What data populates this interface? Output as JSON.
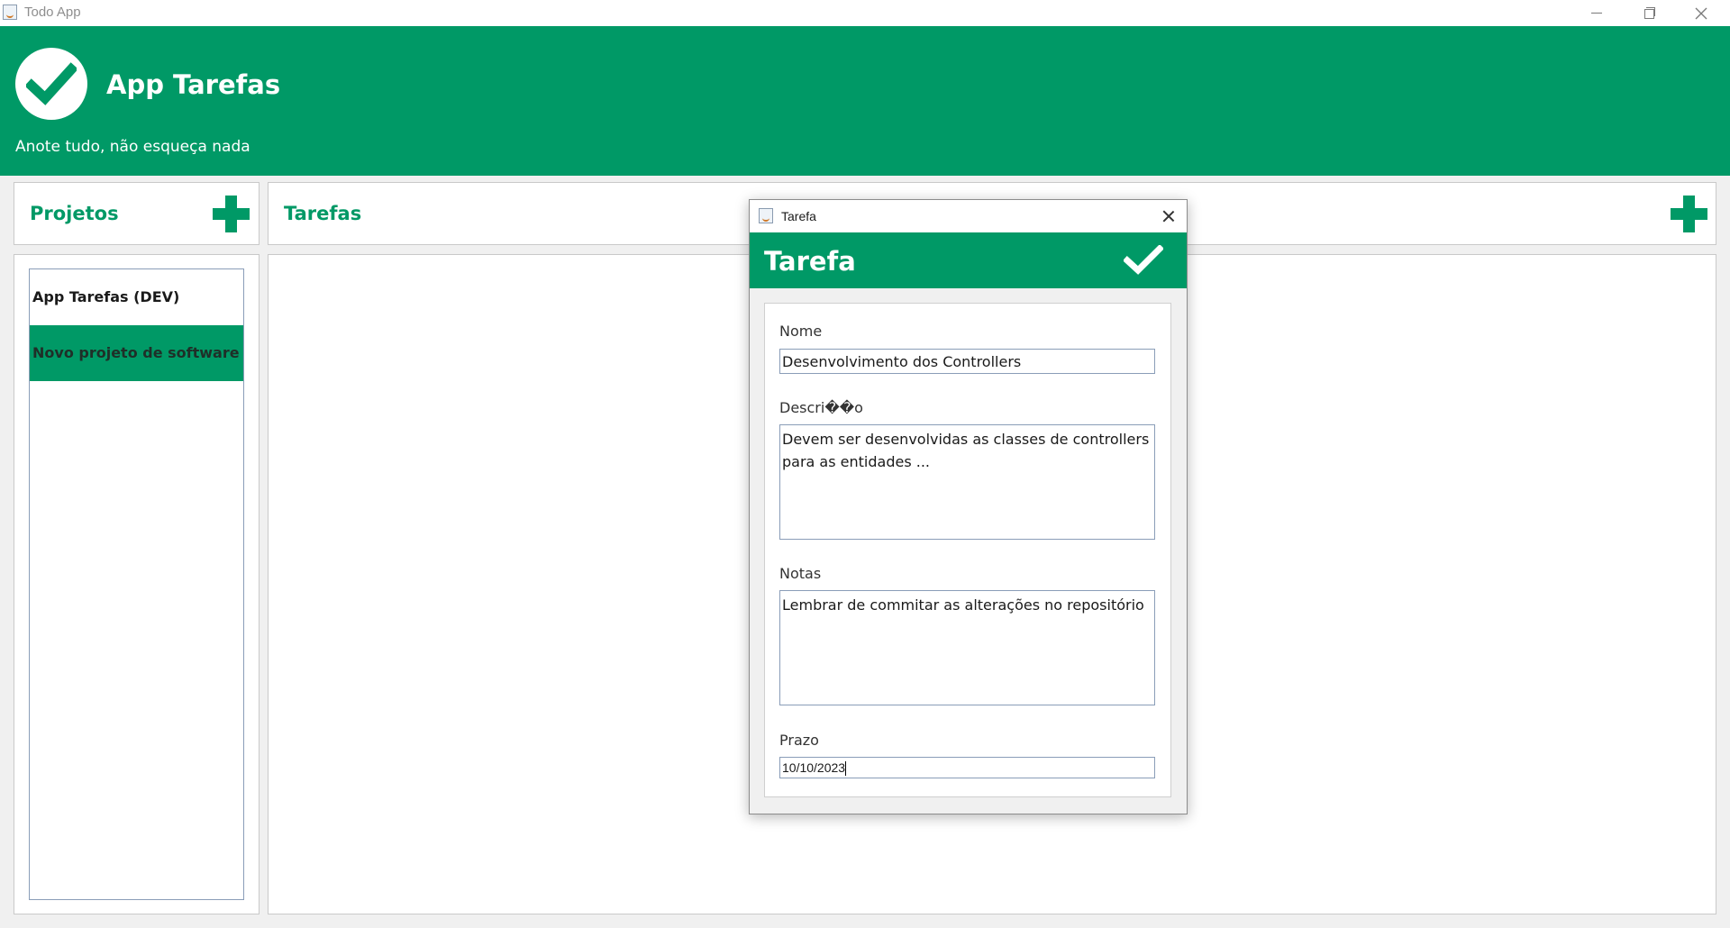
{
  "window": {
    "title": "Todo App",
    "icon": "java-cup-icon"
  },
  "header": {
    "title": "App Tarefas",
    "subtitle": "Anote tudo, não esqueça nada",
    "logo_icon": "check-circle-icon"
  },
  "projects": {
    "title": "Projetos",
    "add_icon": "plus-icon",
    "items": [
      {
        "label": "App Tarefas (DEV)",
        "selected": false
      },
      {
        "label": "Novo projeto de software",
        "selected": true
      }
    ]
  },
  "tasks": {
    "title": "Tarefas",
    "add_icon": "plus-icon"
  },
  "dialog": {
    "window_title": "Tarefa",
    "header_title": "Tarefa",
    "confirm_icon": "check-icon",
    "close_icon": "close-icon",
    "fields": {
      "nome": {
        "label": "Nome",
        "value": "Desenvolvimento dos Controllers"
      },
      "descricao": {
        "label": "Descri��o",
        "value": "Devem ser desenvolvidas as classes de controllers\npara as entidades ..."
      },
      "notas": {
        "label": "Notas",
        "value": "Lembrar de commitar as alterações no repositório"
      },
      "prazo": {
        "label": "Prazo",
        "value": "10/10/2023"
      }
    }
  },
  "colors": {
    "primary": "#009966",
    "background": "#f0f0f0",
    "white": "#ffffff"
  }
}
